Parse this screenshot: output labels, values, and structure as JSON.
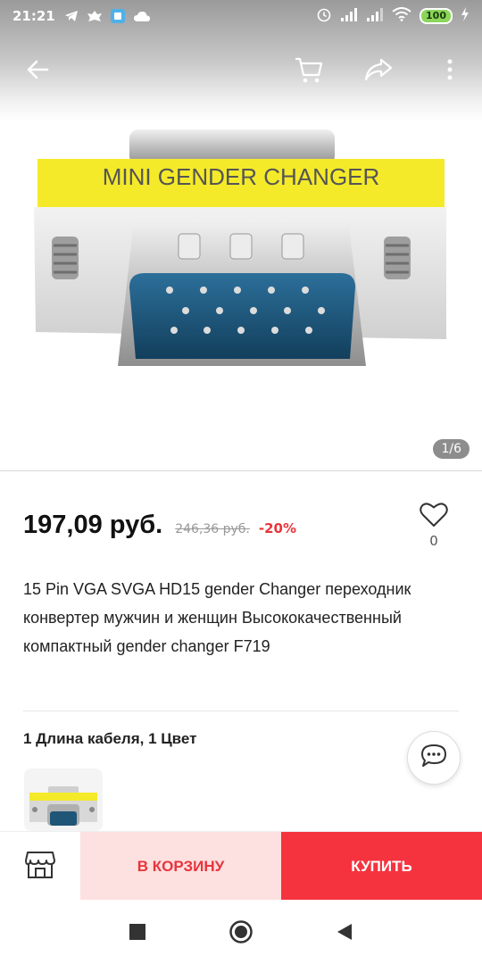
{
  "status_bar": {
    "time": "21:21",
    "battery": "100",
    "icons": [
      "telegram-icon",
      "notification-icon",
      "app-icon",
      "cloud-icon",
      "alarm-icon",
      "signal-icon",
      "signal-icon",
      "wifi-icon",
      "battery-icon",
      "charging-icon"
    ]
  },
  "toolbar": {
    "icons": [
      "back-arrow-icon",
      "cart-icon",
      "share-icon",
      "more-vert-icon"
    ]
  },
  "gallery": {
    "counter": "1/6",
    "product_label": "MINI GENDER CHANGER"
  },
  "product": {
    "price": "197,09 руб.",
    "old_price": "246,36 руб.",
    "discount": "-20%",
    "favorites_count": "0",
    "title": "15 Pin VGA SVGA HD15 gender Changer переходник конвертер мужчин и женщин Высококачественный компактный gender changer F719",
    "variants_label": "1 Длина кабеля, 1 Цвет"
  },
  "actions": {
    "add_to_cart": "В КОРЗИНУ",
    "buy": "КУПИТЬ"
  },
  "colors": {
    "accent": "#f5333f",
    "accent_light": "#fde0e0",
    "discount": "#e8343b",
    "adapter_yellow": "#f4ea2a"
  }
}
